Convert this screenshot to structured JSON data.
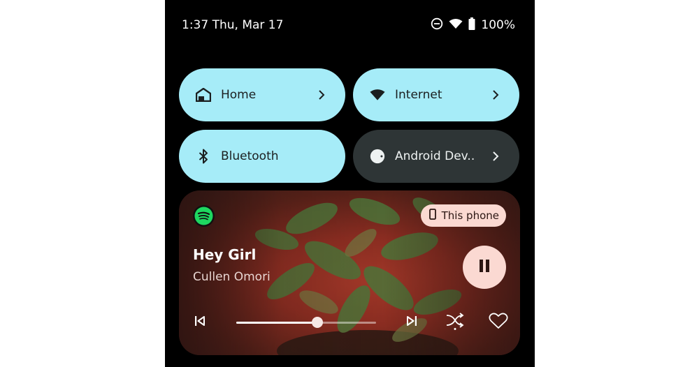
{
  "status_bar": {
    "time_date": "1:37 Thu, Mar 17",
    "icons": [
      "do-not-disturb-icon",
      "wifi-icon",
      "battery-icon"
    ],
    "battery": "100%"
  },
  "tiles": [
    {
      "label": "Home",
      "icon": "home-icon",
      "active": true,
      "has_chevron": true
    },
    {
      "label": "Internet",
      "icon": "wifi-icon",
      "active": true,
      "has_chevron": true
    },
    {
      "label": "Bluetooth",
      "icon": "bluetooth-icon",
      "active": true,
      "has_chevron": false
    },
    {
      "label": "Android Dev..",
      "icon": "android-device-icon",
      "active": false,
      "has_chevron": true
    }
  ],
  "media": {
    "app": "spotify-icon",
    "output_chip": "This phone",
    "title": "Hey Girl",
    "artist": "Cullen Omori",
    "state": "playing",
    "progress": 0.58
  },
  "colors": {
    "tile_active": "#a6ecf8",
    "tile_inactive": "#2e3536",
    "chip_bg": "#fbd9d2",
    "spotify_green": "#1ed760"
  }
}
